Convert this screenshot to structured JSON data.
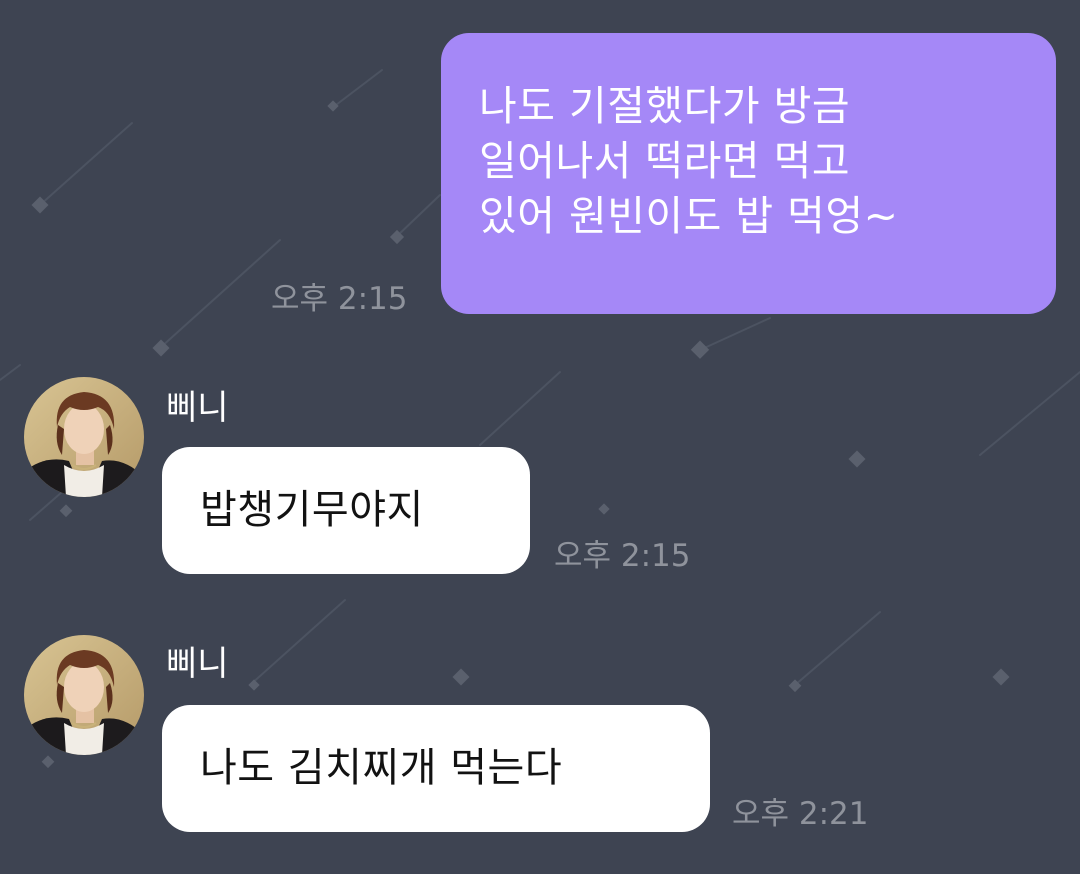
{
  "theme": {
    "background": "#3e4452",
    "outgoing_bubble": "#a588f7",
    "incoming_bubble": "#ffffff",
    "timestamp_color": "#8f939c"
  },
  "messages": [
    {
      "direction": "outgoing",
      "lines": [
        "나도 기절했다가 방금",
        "일어나서 떡라면 먹고",
        "있어 원빈이도 밥 먹엉~"
      ],
      "time": "오후 2:15"
    },
    {
      "direction": "incoming",
      "sender": "삐니",
      "avatar_icon": "profile-photo-avatar",
      "text": "밥챙기무야지",
      "time": "오후 2:15"
    },
    {
      "direction": "incoming",
      "sender": "삐니",
      "avatar_icon": "profile-photo-avatar",
      "text": "나도 김치찌개 먹는다",
      "time": "오후 2:21"
    }
  ]
}
